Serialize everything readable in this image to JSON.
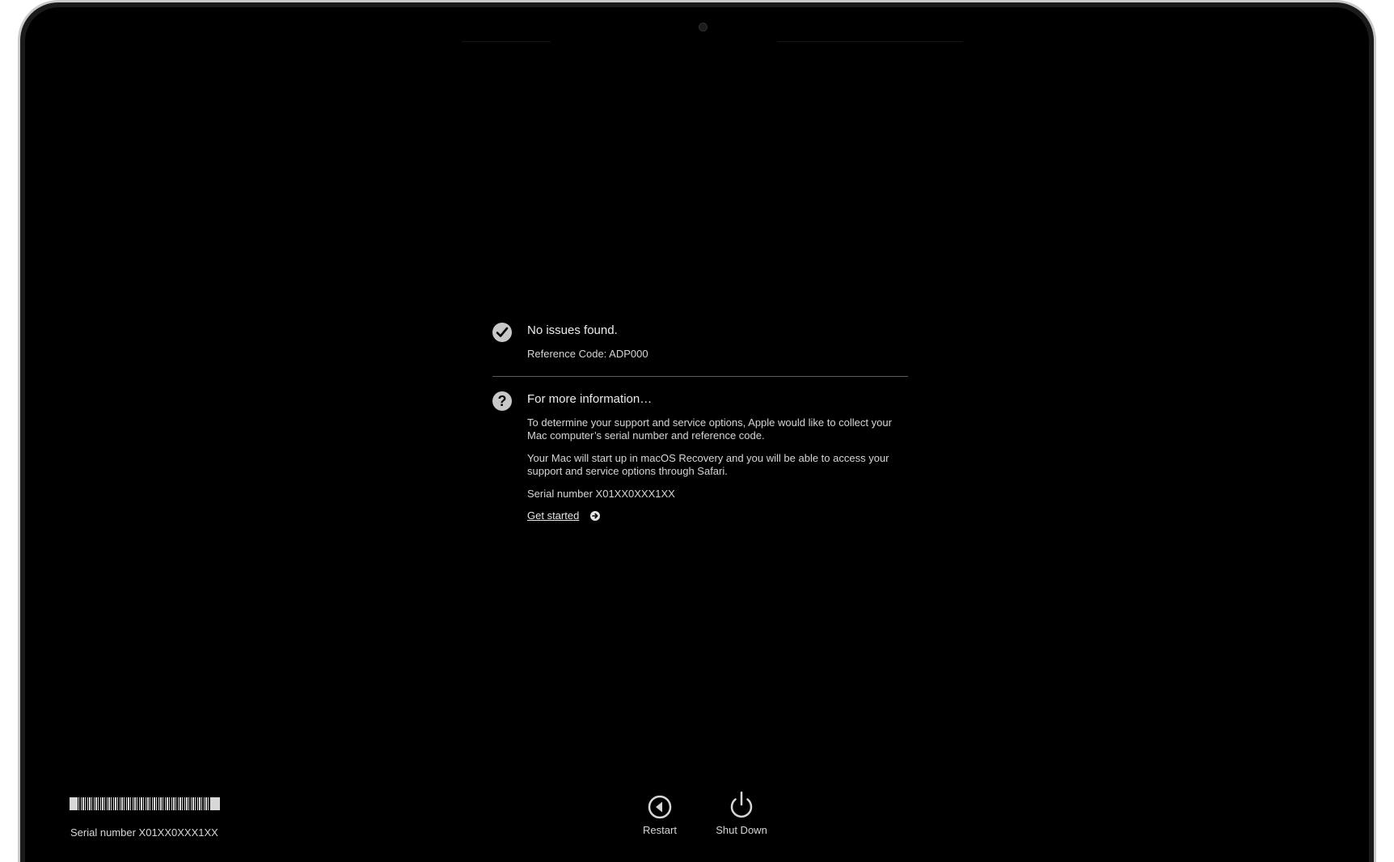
{
  "result": {
    "title": "No issues found.",
    "reference_code": "Reference Code: ADP000"
  },
  "more_info": {
    "title": "For more information…",
    "paragraph1": "To determine your support and service options, Apple would like to collect your Mac computer’s serial number and reference code.",
    "paragraph2": "Your Mac will start up in macOS Recovery and you will be able to access your support and service options through Safari.",
    "serial": "Serial number X01XX0XXX1XX",
    "link_label": "Get started"
  },
  "buttons": {
    "restart_label": "Restart",
    "shutdown_label": "Shut Down"
  },
  "footer": {
    "serial": "Serial number X01XX0XXX1XX"
  },
  "icons": {
    "check": "checkmark-circle-icon",
    "question": "question-circle-icon",
    "arrow": "arrow-right-circle-icon",
    "restart": "restart-icon",
    "power": "power-icon"
  },
  "colors": {
    "screen_bg": "#000000",
    "text": "#e6e6e6",
    "bezel": "#c9c9c9"
  }
}
